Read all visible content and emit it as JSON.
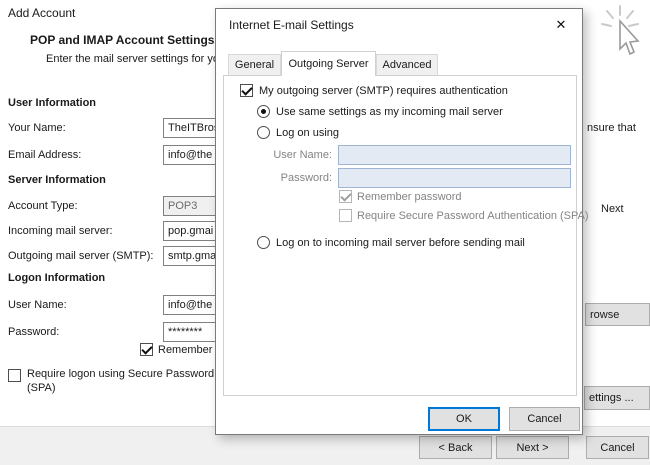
{
  "colors": {
    "accent": "#0078d7",
    "window_bg": "#ffffff",
    "footer_bg": "#f0f0f0"
  },
  "background": {
    "window_title": "Add Account",
    "heading": "POP and IMAP Account Settings",
    "subheading": "Enter the mail server settings for your",
    "user_info": {
      "title": "User Information",
      "your_name_label": "Your Name:",
      "your_name_value": "TheITBros",
      "email_label": "Email Address:",
      "email_value": "info@the"
    },
    "server_info": {
      "title": "Server Information",
      "account_type_label": "Account Type:",
      "account_type_value": "POP3",
      "incoming_label": "Incoming mail server:",
      "incoming_value": "pop.gmai",
      "outgoing_label": "Outgoing mail server (SMTP):",
      "outgoing_value": "smtp.gma"
    },
    "logon_info": {
      "title": "Logon Information",
      "user_name_label": "User Name:",
      "user_name_value": "info@the",
      "password_label": "Password:",
      "password_value": "********",
      "remember_label": "Remember pa"
    },
    "spa_line1": "Require logon using Secure Password",
    "spa_line2": "(SPA)",
    "fragments": {
      "ensure": "nsure that",
      "next": "Next",
      "browse": "rowse",
      "settings": "ettings ..."
    },
    "footer": {
      "back": "< Back",
      "next": "Next >",
      "cancel": "Cancel"
    }
  },
  "dialog": {
    "title": "Internet E-mail Settings",
    "close_glyph": "✕",
    "tabs": [
      {
        "label": "General"
      },
      {
        "label": "Outgoing Server"
      },
      {
        "label": "Advanced"
      }
    ],
    "active_tab": "Outgoing Server",
    "auth_checkbox": "My outgoing server (SMTP) requires authentication",
    "radio_same": "Use same settings as my incoming mail server",
    "radio_logon": "Log on using",
    "user_name_label": "User Name:",
    "password_label": "Password:",
    "remember_checkbox": "Remember password",
    "spa_checkbox": "Require Secure Password Authentication (SPA)",
    "radio_incoming": "Log on to incoming mail server before sending mail",
    "ok": "OK",
    "cancel": "Cancel"
  }
}
